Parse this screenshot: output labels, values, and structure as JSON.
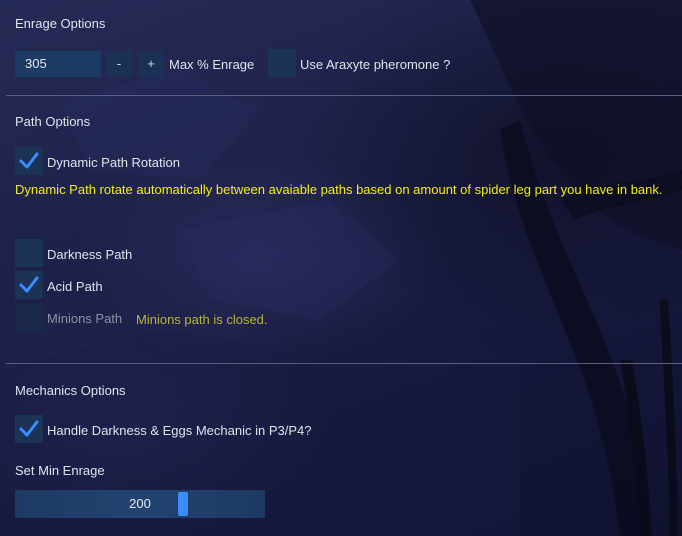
{
  "enrage": {
    "section_title": "Enrage Options",
    "value": "305",
    "minus_label": "-",
    "plus_label": "+",
    "max_label": "Max % Enrage",
    "pheromone_label": "Use Araxyte pheromone ?",
    "pheromone_checked": false
  },
  "path": {
    "section_title": "Path Options",
    "dynamic_label": "Dynamic Path Rotation",
    "dynamic_checked": true,
    "dynamic_note": "Dynamic Path rotate automatically between avaiable paths based on amount of spider leg part you have in bank.",
    "darkness_label": "Darkness Path",
    "darkness_checked": false,
    "acid_label": "Acid Path",
    "acid_checked": true,
    "minions_label": "Minions Path",
    "minions_checked": false,
    "minions_note": "Minions path is closed."
  },
  "mechanics": {
    "section_title": "Mechanics Options",
    "handle_label": "Handle Darkness & Eggs Mechanic in P3/P4?",
    "handle_checked": true,
    "min_enrage_label": "Set Min Enrage",
    "min_enrage_value": "200",
    "min_enrage_fraction": 0.65
  },
  "colors": {
    "accent": "#3a8cff",
    "warning": "#f2ee1a",
    "warning_dim": "#b7b33a"
  }
}
